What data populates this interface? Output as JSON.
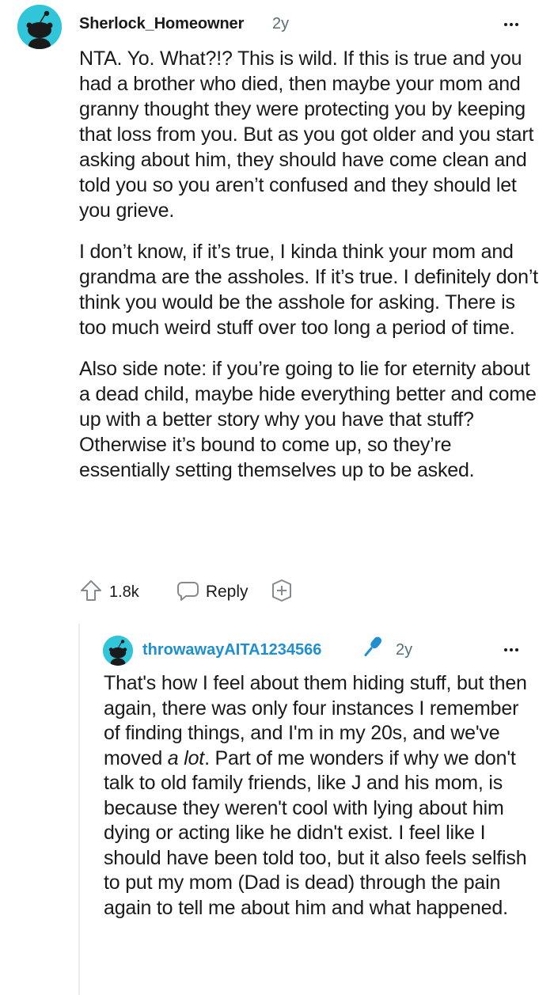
{
  "comment": {
    "author": "Sherlock_Homeowner",
    "time": "2y",
    "paragraphs": [
      "NTA. Yo. What?!? This is wild. If this is true and you had a brother who died, then maybe your mom and granny thought they were protecting you by keeping that loss from you. But as you got older and you start asking about him, they should have come clean and told you so you aren’t confused and they should let you grieve.",
      "I don’t know, if it’s true, I kinda think your mom and grandma are the assholes. If it’s true. I definitely don’t think you would be the asshole for asking. There is too much weird stuff over too long a period of time.",
      "Also side note: if you’re going to lie for eternity about a dead child, maybe hide everything better and come up with a better story why you have that stuff? Otherwise it’s bound to come up, so they’re essentially setting themselves up to be asked."
    ],
    "upvotes": "1.8k",
    "reply_label": "Reply",
    "icons": {
      "avatar": "snoo-avatar-icon",
      "upvote": "upvote-arrow-icon",
      "reply": "speech-bubble-icon",
      "award": "plus-award-icon",
      "more": "more-options-icon"
    }
  },
  "reply": {
    "author": "throwawayAITA1234566",
    "author_flair_icon": "microphone-icon",
    "time": "2y",
    "text_before_em": "That's how I feel about them hiding stuff, but then again, there was only four instances I remember of finding things, and I'm in my 20s, and we've moved ",
    "text_em": "a lot",
    "text_after_em": ". Part of me wonders if why we don't talk to old family friends, like J and his mom, is because they weren't cool with lying about him dying or acting like he didn't exist. I feel like I should have been told too, but it also feels selfish to put my mom (Dad is dead) through the pain again to tell me about him and what happened."
  },
  "colors": {
    "text": "#1a1a1b",
    "meta": "#576f76",
    "op_username": "#1e8fd1",
    "avatar_bg": "#31c5d9",
    "thread_line": "#e5ebee",
    "icon_gray": "#878a8c"
  }
}
